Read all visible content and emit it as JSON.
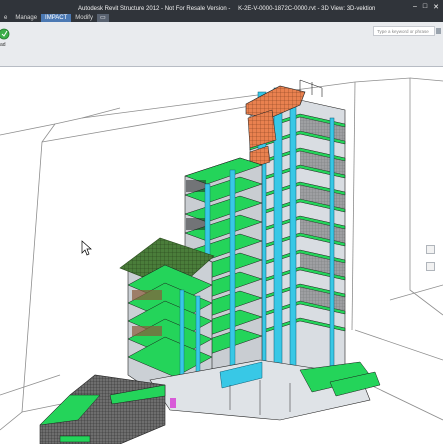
{
  "window": {
    "title_app": "Autodesk Revit Structure 2012 - Not For Resale Version -",
    "title_file": "K-2E-V-0000-1872C-0000.rvt - 3D View: 3D-vektion",
    "controls": [
      "–",
      "□",
      "✕"
    ]
  },
  "tabs": [
    {
      "label": "e"
    },
    {
      "label": "Manage"
    },
    {
      "label": "IMPACT",
      "active": true
    },
    {
      "label": "Modify"
    },
    {
      "label": "▭"
    }
  ],
  "ribbon": {
    "button_label": "ad",
    "button_icon": "green-circle-icon",
    "search_placeholder": "Type a keyword or phrase"
  },
  "viewport": {
    "view_type": "3D View",
    "model": "structural high-rise tower (steel frame, green slab edges, cyan columns, orange roof panels)",
    "colors": {
      "slab": "#24d45a",
      "column": "#38c8e6",
      "roof": "#e9814f",
      "frame": "#1b1b1b",
      "section_box": "#8a8a8a"
    },
    "side_icons": [
      "orbit-icon",
      "zoom-icon"
    ]
  }
}
